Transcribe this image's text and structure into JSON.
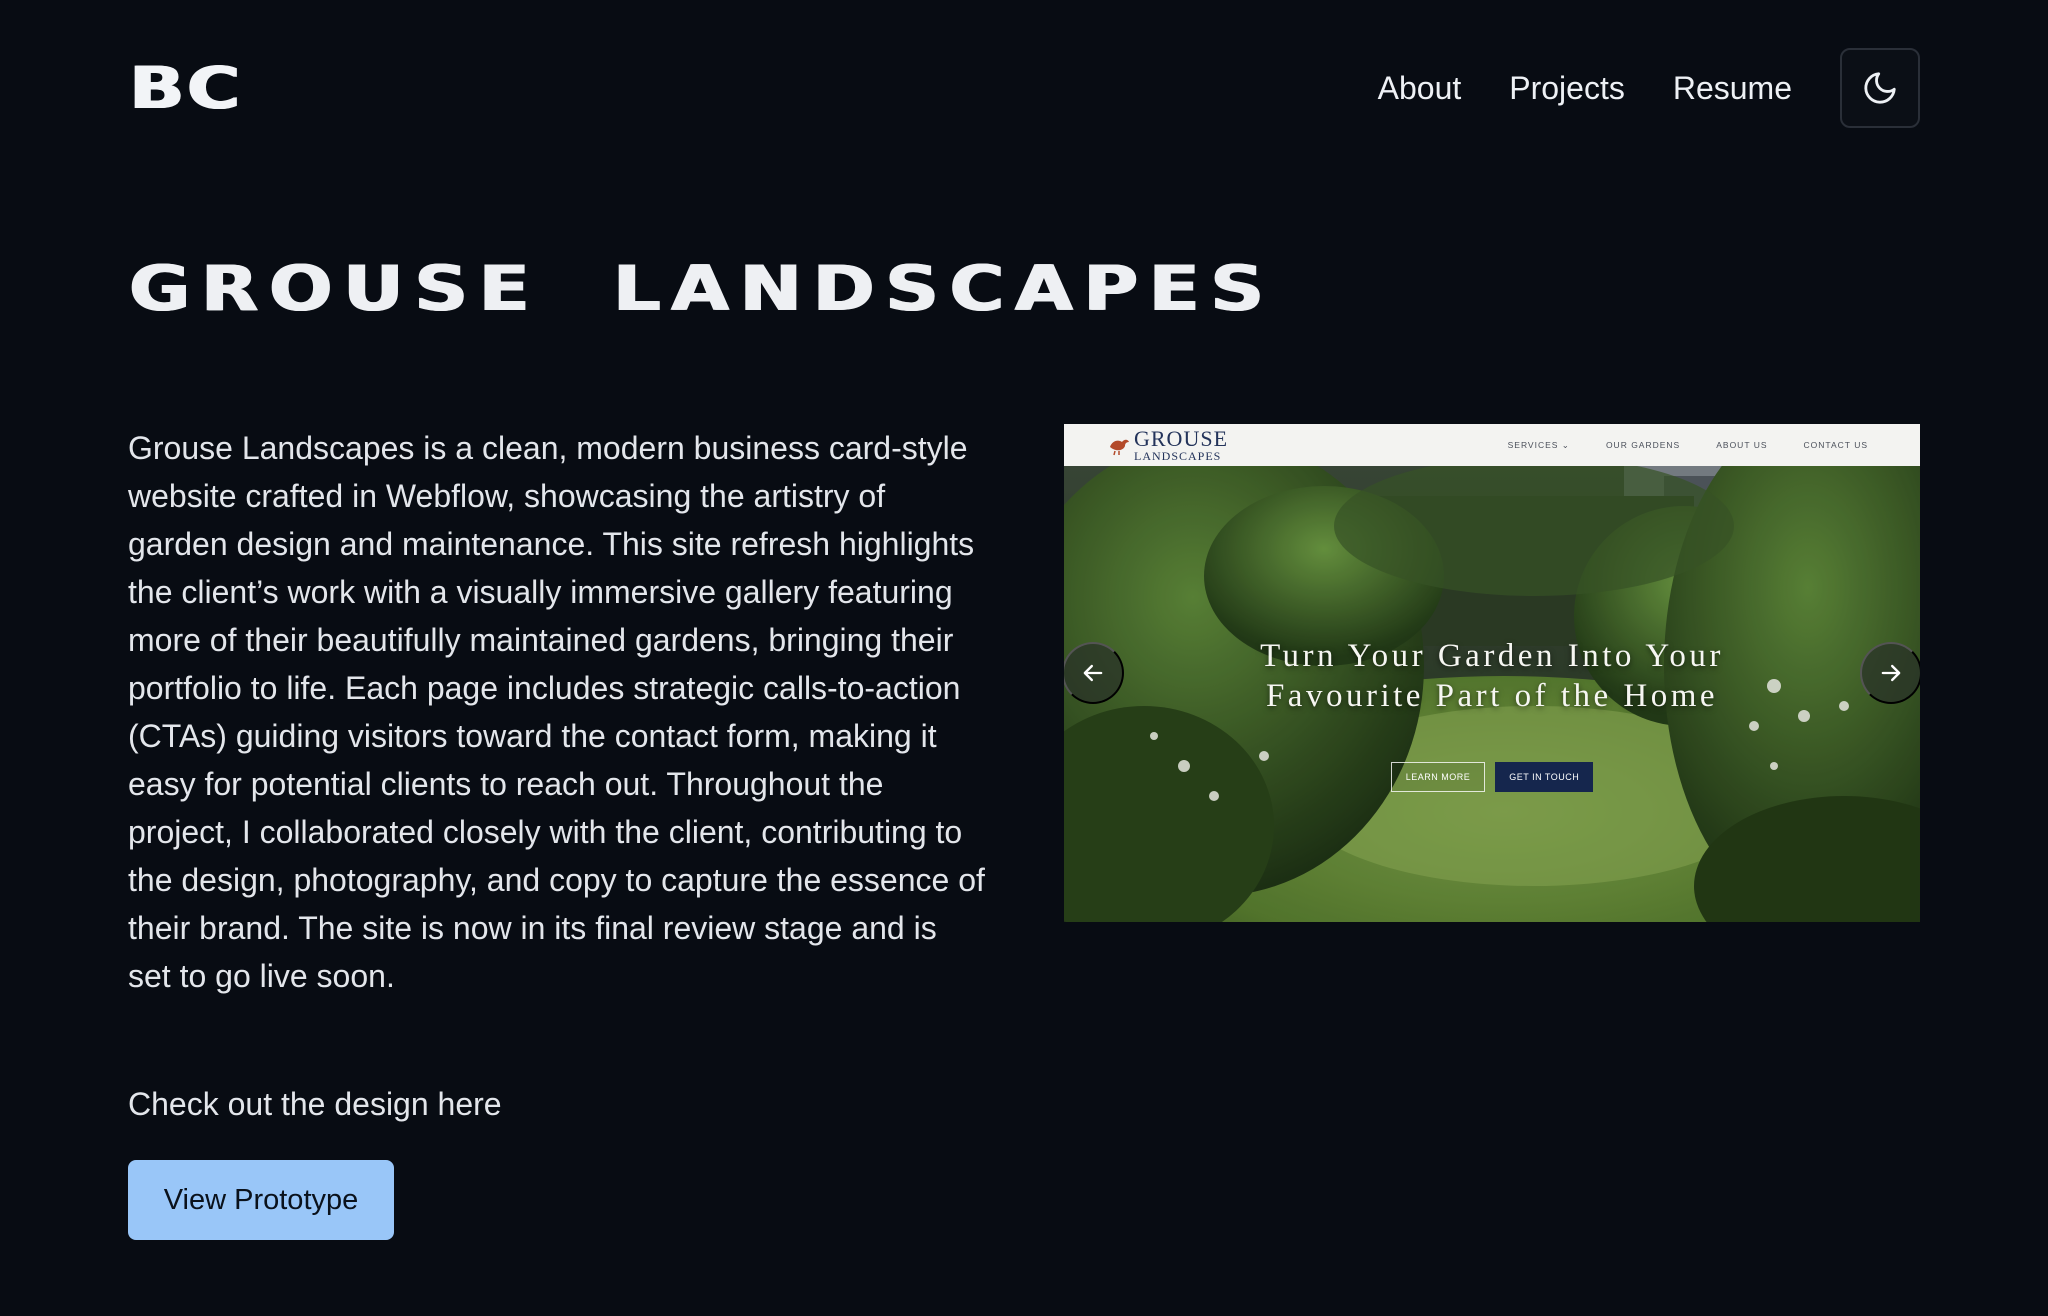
{
  "header": {
    "logo": "BC",
    "nav": [
      "About",
      "Projects",
      "Resume"
    ],
    "theme_toggle_icon": "moon-icon"
  },
  "project": {
    "title": "GROUSE LANDSCAPES",
    "description": "Grouse Landscapes is a clean, modern business card-style website crafted in Webflow, showcasing the artistry of garden design and maintenance. This site refresh highlights the client’s work with a visually immersive gallery featuring more of their beautifully maintained gardens, bringing their portfolio to life. Each page includes strategic calls-to-action (CTAs) guiding visitors toward the contact form, making it easy for potential clients to reach out. Throughout the project, I collaborated closely with the client, contributing to the design, photography, and copy to capture the essence of their brand. The site is now in its final review stage and is set to go live soon.",
    "cta_text": "Check out the design here",
    "button_label": "View Prototype"
  },
  "carousel": {
    "prev_icon": "arrow-left-icon",
    "next_icon": "arrow-right-icon",
    "screenshot": {
      "logo_top": "GROUSE",
      "logo_bottom": "LANDSCAPES",
      "menu": [
        "SERVICES ⌄",
        "OUR GARDENS",
        "ABOUT US",
        "CONTACT US"
      ],
      "headline_line1": "Turn Your Garden Into Your",
      "headline_line2": "Favourite Part of the Home",
      "learn_more": "LEARN MORE",
      "get_in_touch": "GET IN TOUCH"
    }
  },
  "colors": {
    "background": "#080c13",
    "button": "#99c6f8",
    "text": "#e6e9ee"
  }
}
